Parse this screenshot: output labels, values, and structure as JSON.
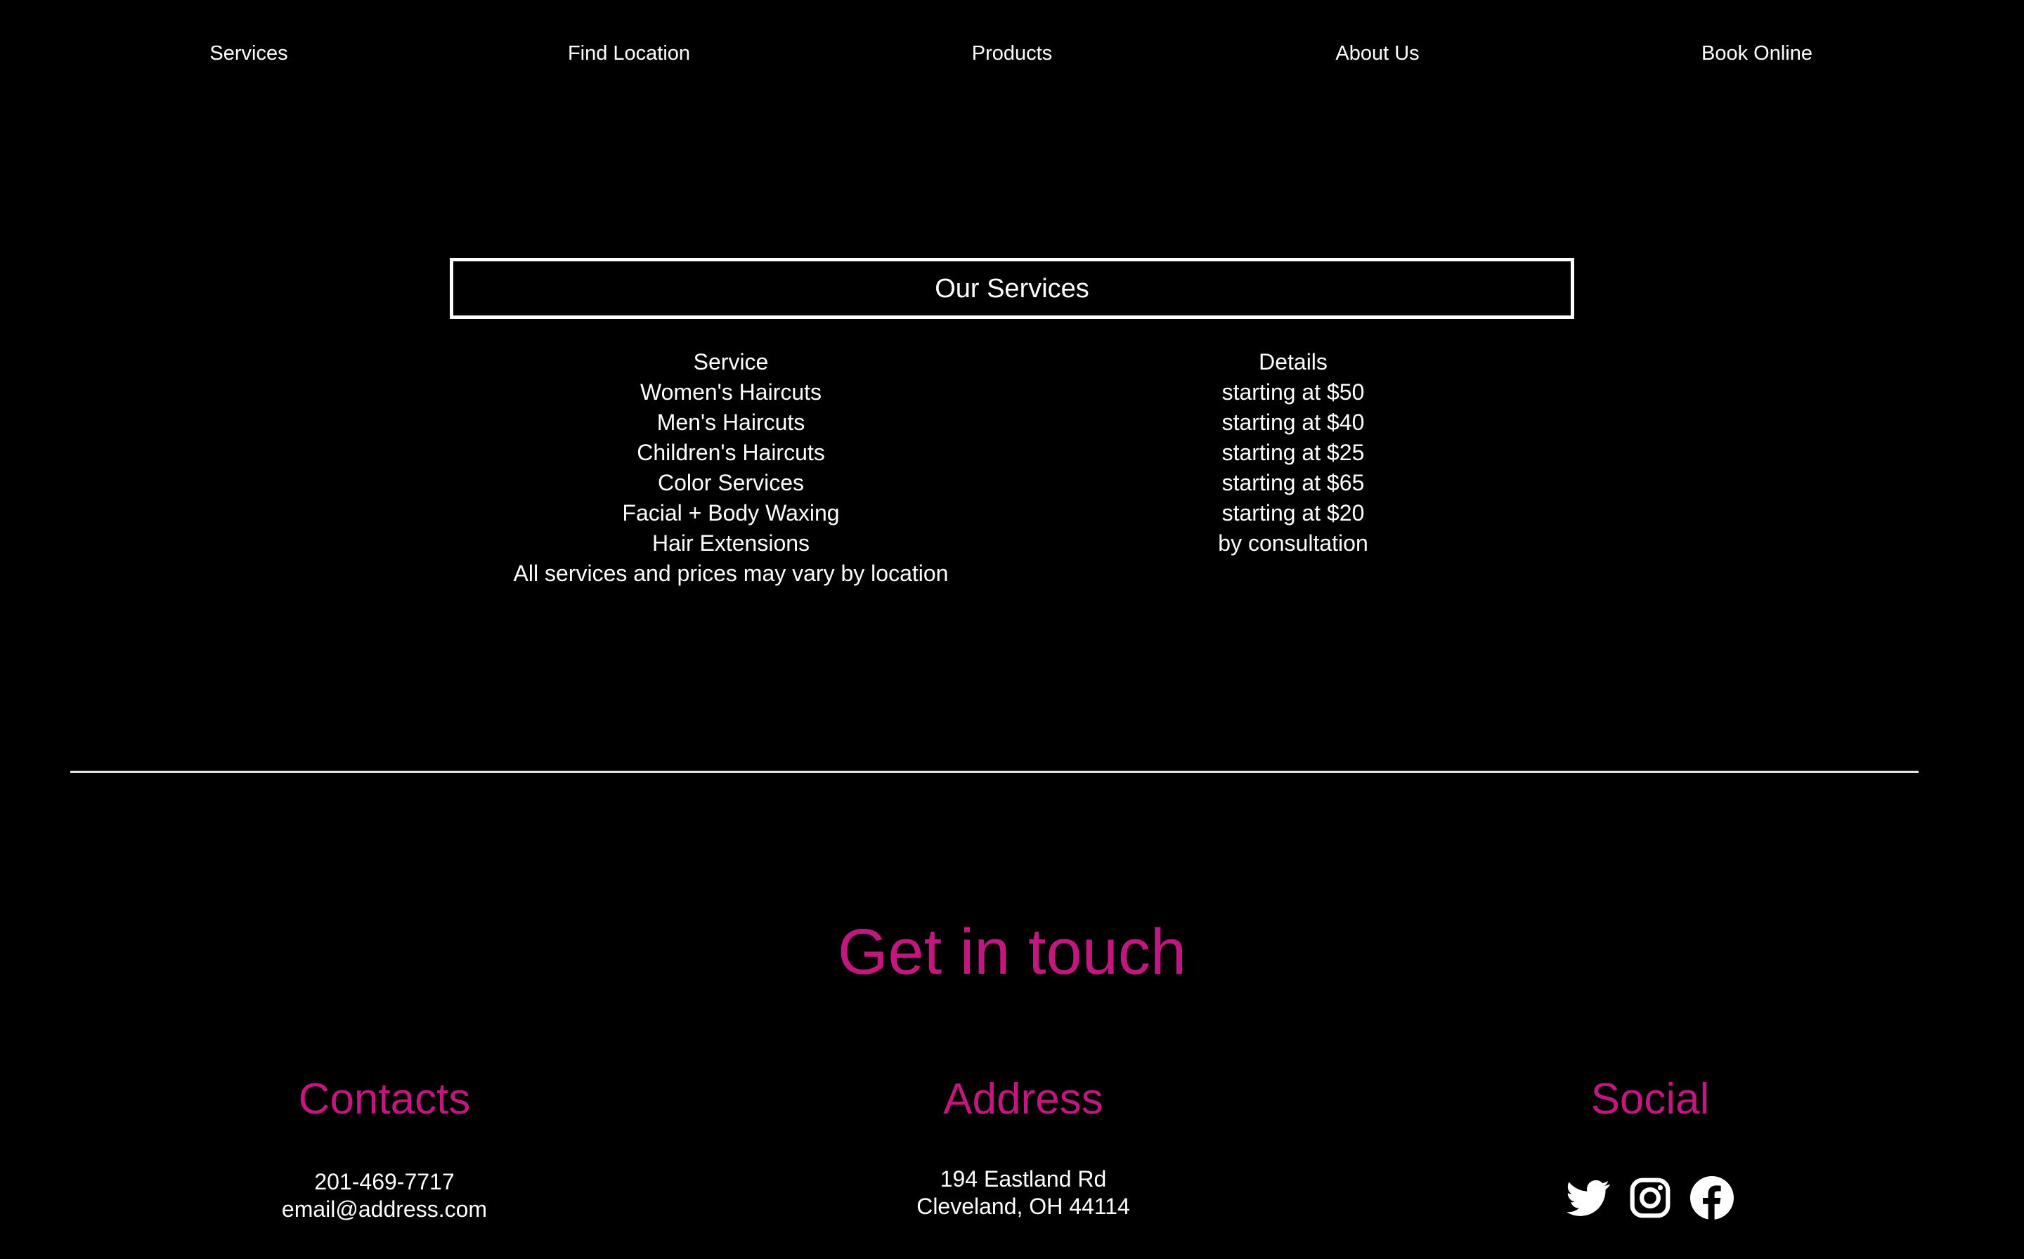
{
  "nav": {
    "items": [
      {
        "label": "Services"
      },
      {
        "label": "Find Location"
      },
      {
        "label": "Products"
      },
      {
        "label": "About Us"
      },
      {
        "label": "Book Online"
      }
    ]
  },
  "services": {
    "title": "Our Services",
    "header_service": "Service",
    "header_details": "Details",
    "rows": [
      {
        "service": "Women's Haircuts",
        "details": "starting at $50"
      },
      {
        "service": "Men's Haircuts",
        "details": "starting at $40"
      },
      {
        "service": "Children's Haircuts",
        "details": "starting at $25"
      },
      {
        "service": "Color Services",
        "details": "starting at $65"
      },
      {
        "service": "Facial + Body Waxing",
        "details": "starting at $20"
      },
      {
        "service": "Hair Extensions",
        "details": "by consultation"
      }
    ],
    "note": "All services and prices may vary by location"
  },
  "footer": {
    "title": "Get in touch",
    "contacts": {
      "heading": "Contacts",
      "phone": "201-469-7717",
      "email": "email@address.com"
    },
    "address": {
      "heading": "Address",
      "line1": "194 Eastland Rd",
      "line2": "Cleveland, OH 44114"
    },
    "social": {
      "heading": "Social",
      "icons": [
        "twitter-icon",
        "instagram-icon",
        "facebook-icon"
      ]
    }
  },
  "colors": {
    "background": "#000000",
    "text": "#ffffff",
    "accent": "#c2177e"
  }
}
